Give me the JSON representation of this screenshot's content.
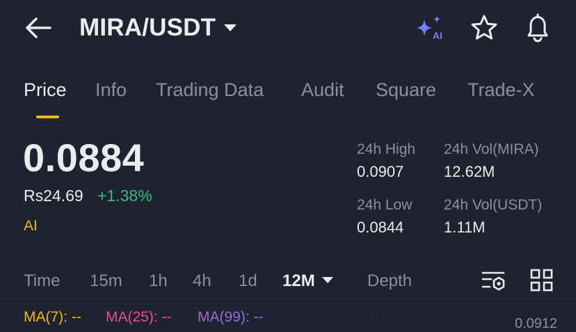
{
  "header": {
    "pair": "MIRA/USDT",
    "ai_badge": "AI"
  },
  "tabs": [
    "Price",
    "Info",
    "Trading Data",
    "Audit",
    "Square",
    "Trade-X"
  ],
  "price": {
    "last": "0.0884",
    "fiat": "Rs24.69",
    "change": "+1.38%",
    "tag": "AI"
  },
  "stats": {
    "high_label": "24h High",
    "high_value": "0.0907",
    "vol_base_label": "24h Vol(MIRA)",
    "vol_base_value": "12.62M",
    "low_label": "24h Low",
    "low_value": "0.0844",
    "vol_quote_label": "24h Vol(USDT)",
    "vol_quote_value": "1.11M"
  },
  "timeframes": [
    "Time",
    "15m",
    "1h",
    "4h",
    "1d",
    "12M",
    "Depth"
  ],
  "selected_timeframe": "12M",
  "ma": {
    "ma7": "MA(7): --",
    "ma25": "MA(25): --",
    "ma99": "MA(99): --"
  },
  "chart_right_value": "0.0912",
  "colors": {
    "background": "#1f2330",
    "accent": "#f0b90b",
    "up": "#2ebd85",
    "ma7": "#f0b90b",
    "ma25": "#e84d9a",
    "ma99": "#9b6cd8"
  }
}
